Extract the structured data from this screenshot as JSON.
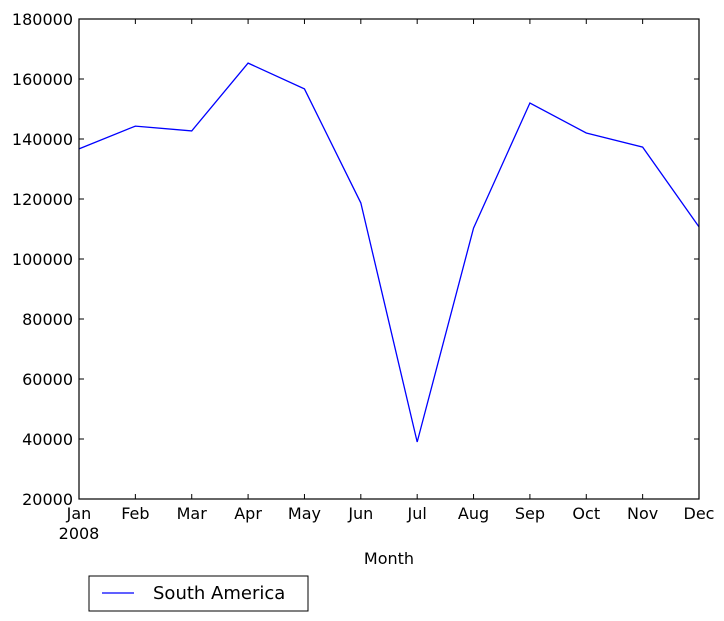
{
  "chart_data": {
    "type": "line",
    "title": "",
    "xlabel": "Month",
    "ylabel": "",
    "categories": [
      "Jan",
      "Feb",
      "Mar",
      "Apr",
      "May",
      "Jun",
      "Jul",
      "Aug",
      "Sep",
      "Oct",
      "Nov",
      "Dec"
    ],
    "x_sublabel": "2008",
    "ylim": [
      20000,
      180000
    ],
    "yticks": [
      20000,
      40000,
      60000,
      80000,
      100000,
      120000,
      140000,
      160000,
      180000
    ],
    "grid": false,
    "legend_position": "bottom-left, below axes",
    "series": [
      {
        "name": "South America",
        "color": "#0000ff",
        "values": [
          136700,
          144300,
          142700,
          165300,
          156700,
          118700,
          39000,
          110300,
          152000,
          142000,
          137300,
          110700
        ]
      }
    ]
  }
}
